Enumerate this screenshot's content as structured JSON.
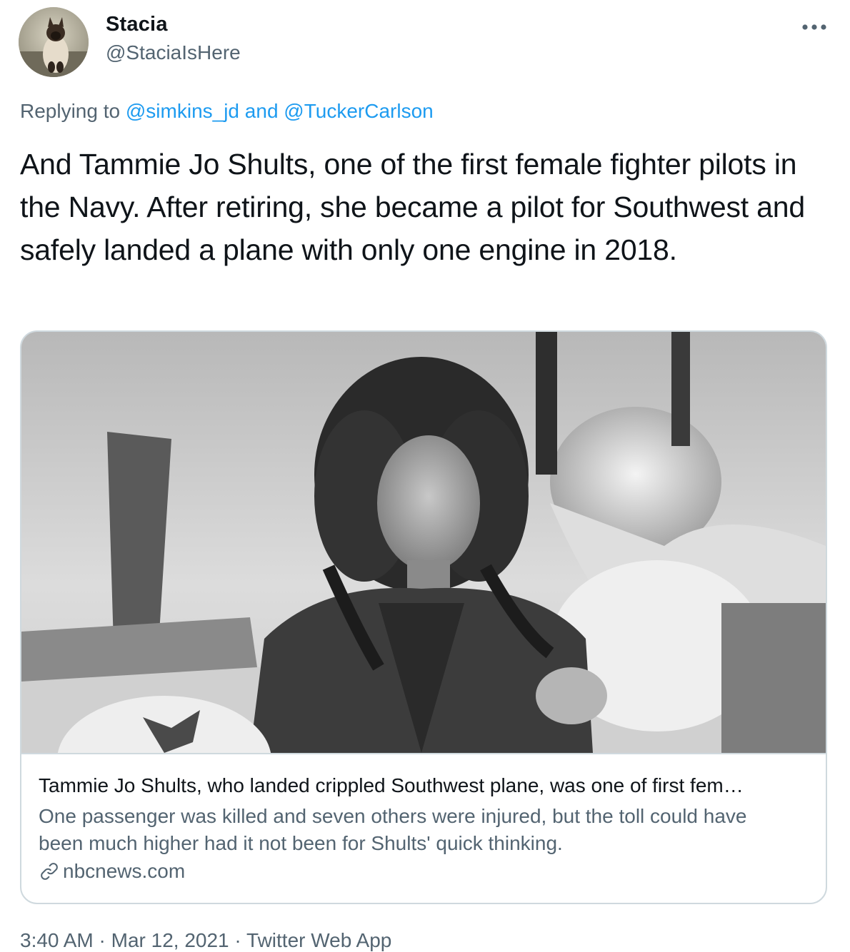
{
  "author": {
    "name": "Stacia",
    "handle": "@StaciaIsHere"
  },
  "reply": {
    "prefix": "Replying to",
    "user1": "@simkins_jd",
    "conjunction": "and",
    "user2": "@TuckerCarlson"
  },
  "tweet": {
    "text": "And Tammie Jo Shults, one of the first female fighter pilots in the Navy. After retiring, she became a pilot for Southwest and safely landed a plane with only one engine in 2018."
  },
  "card": {
    "title": "Tammie Jo Shults, who landed crippled Southwest plane, was one of first fem…",
    "description": "One passenger was killed and seven others were injured, but the toll could have been much higher had it not been for Shults' quick thinking.",
    "domain": "nbcnews.com",
    "icon": "link-icon"
  },
  "meta": {
    "time": "3:40 AM",
    "separator1": "·",
    "date": "Mar 12, 2021",
    "separator2": "·",
    "client": "Twitter Web App"
  },
  "colors": {
    "text": "#0f1419",
    "secondary": "#536471",
    "link": "#1d9bf0",
    "border": "#cfd9de"
  }
}
